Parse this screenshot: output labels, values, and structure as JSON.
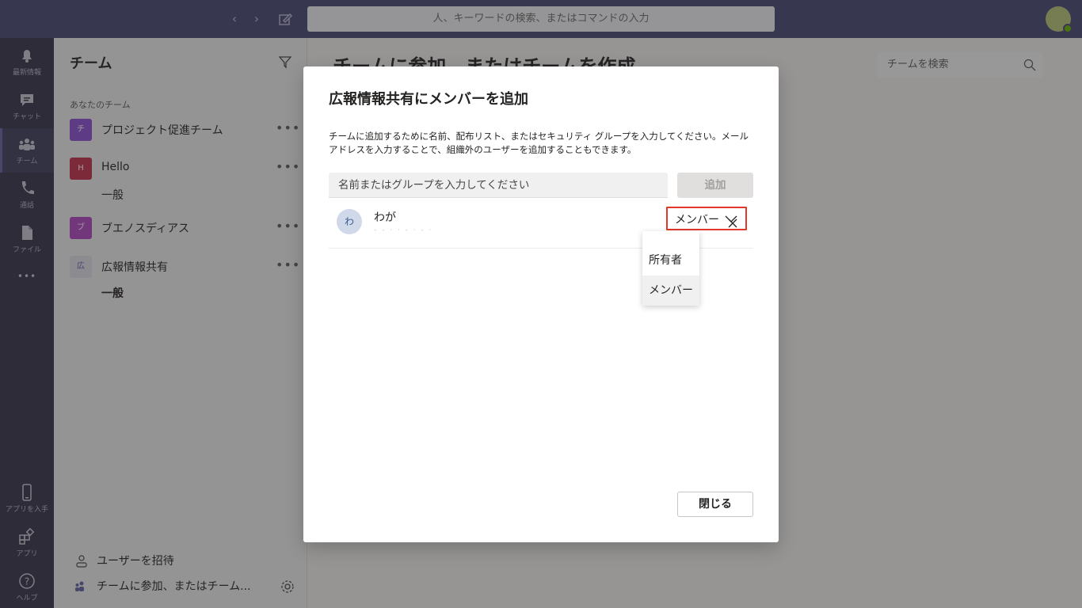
{
  "topbar": {
    "search_placeholder": "人、キーワードの検索、またはコマンドの入力"
  },
  "rail": {
    "items": [
      {
        "label": "最新情報",
        "icon": "bell-icon"
      },
      {
        "label": "チャット",
        "icon": "chat-icon"
      },
      {
        "label": "チーム",
        "icon": "teams-icon"
      },
      {
        "label": "通話",
        "icon": "phone-icon"
      },
      {
        "label": "ファイル",
        "icon": "file-icon"
      },
      {
        "label": "•••",
        "icon": "more-icon"
      },
      {
        "label": "アプリを入手",
        "icon": "mobile-icon"
      },
      {
        "label": "アプリ",
        "icon": "apps-icon"
      },
      {
        "label": "ヘルプ",
        "icon": "help-icon"
      }
    ]
  },
  "sidebar": {
    "title": "チーム",
    "section_label": "あなたのチーム",
    "teams": [
      {
        "name": "プロジェクト促進チーム",
        "tile": "チ",
        "color": "#8c4fd6"
      },
      {
        "name": "Hello",
        "tile": "H",
        "color": "#c4314b",
        "channel": "一般"
      },
      {
        "name": "ブエノスディアス",
        "tile": "ブ",
        "color": "#b146c2"
      },
      {
        "name": "広報情報共有",
        "tile": "広",
        "color": "#e1e1ea",
        "channel": "一般"
      }
    ],
    "footer": {
      "invite": "ユーザーを招待",
      "join": "チームに参加、またはチーム..."
    }
  },
  "main": {
    "title": "チームに参加、またはチームを作成",
    "team_search_placeholder": "チームを検索"
  },
  "dialog": {
    "title": "広報情報共有にメンバーを追加",
    "description": "チームに追加するために名前、配布リスト、またはセキュリティ グループを入力してください。メールアドレスを入力することで、組織外のユーザーを追加することもできます。",
    "input_placeholder": "名前またはグループを入力してください",
    "add_button": "追加",
    "member": {
      "avatar": "わ",
      "name": "わが",
      "role": "メンバー"
    },
    "role_options": [
      "所有者",
      "メンバー"
    ],
    "close_button": "閉じる"
  }
}
